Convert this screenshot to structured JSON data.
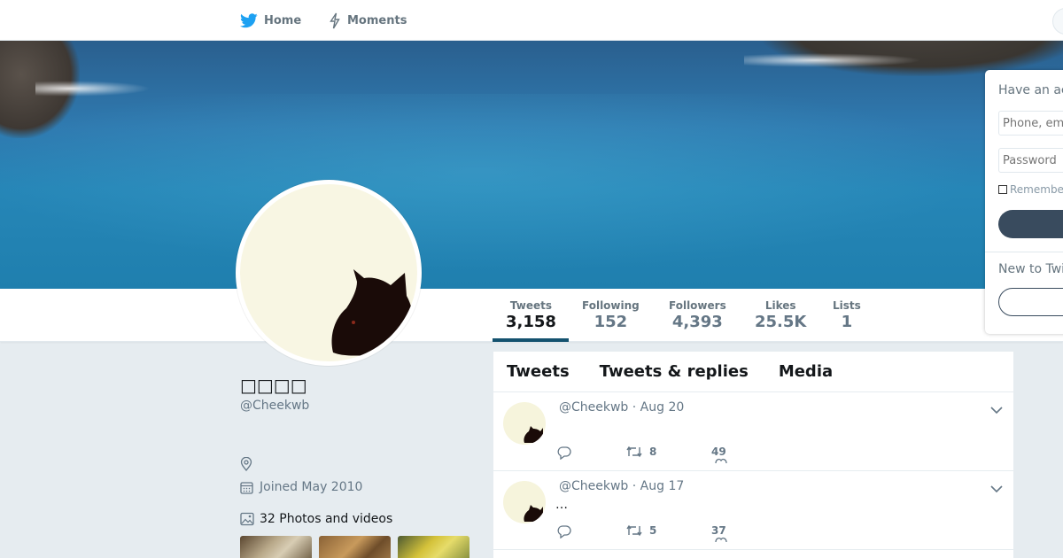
{
  "nav": {
    "home_label": "Home",
    "moments_label": "Moments"
  },
  "profile": {
    "name": "□□□□",
    "handle": "@Cheekwb",
    "joined": "Joined May 2010",
    "photos_label": "32 Photos and videos"
  },
  "stats": [
    {
      "label": "Tweets",
      "value": "3,158"
    },
    {
      "label": "Following",
      "value": "152"
    },
    {
      "label": "Followers",
      "value": "4,393"
    },
    {
      "label": "Likes",
      "value": "25.5K"
    },
    {
      "label": "Lists",
      "value": "1"
    }
  ],
  "timeline": {
    "tabs": [
      "Tweets",
      "Tweets & replies",
      "Media"
    ],
    "tweets": [
      {
        "header": "@Cheekwb · Aug 20",
        "text": "",
        "retweets": "8",
        "likes": "49"
      },
      {
        "header": "@Cheekwb · Aug 17",
        "text": "…",
        "retweets": "5",
        "likes": "37"
      }
    ]
  },
  "login": {
    "heading": "Have an ac",
    "phone_placeholder": "Phone, em",
    "password_placeholder": "Password",
    "remember_label": "Remembe",
    "new_to_label": "New to Twi"
  },
  "colors": {
    "accent": "#1da1f2",
    "background": "#e6ecf0",
    "button_dark": "#394b5e"
  }
}
